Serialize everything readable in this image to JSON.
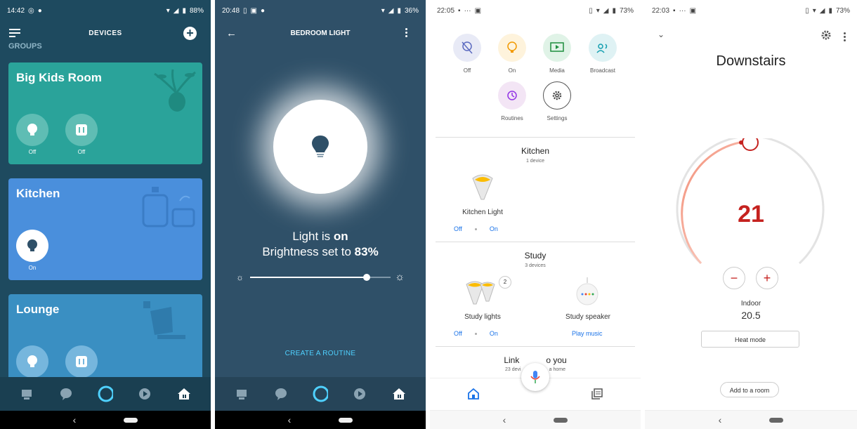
{
  "panel1": {
    "status": {
      "time": "14:42",
      "battery": "88%"
    },
    "title": "DEVICES",
    "groups_label": "GROUPS",
    "cards": [
      {
        "name": "Big Kids Room",
        "devices": [
          {
            "state": "Off"
          },
          {
            "state": "Off"
          }
        ]
      },
      {
        "name": "Kitchen",
        "devices": [
          {
            "state": "On"
          }
        ]
      },
      {
        "name": "Lounge"
      }
    ]
  },
  "panel2": {
    "status": {
      "time": "20:48",
      "battery": "36%"
    },
    "title": "BEDROOM LIGHT",
    "light_prefix": "Light is ",
    "light_state": "on",
    "brightness_prefix": "Brightness set to ",
    "brightness": "83%",
    "brightness_level": 0.83,
    "routine_link": "CREATE A ROUTINE"
  },
  "panel3": {
    "status": {
      "time": "22:05",
      "battery": "73%"
    },
    "actions": [
      "Off",
      "On",
      "Media",
      "Broadcast",
      "Routines",
      "Settings"
    ],
    "rooms": [
      {
        "name": "Kitchen",
        "count": "1 device",
        "devices": [
          {
            "name": "Kitchen Light",
            "off": "Off",
            "on": "On"
          }
        ]
      },
      {
        "name": "Study",
        "count": "3 devices",
        "devices": [
          {
            "name": "Study lights",
            "badge": "2",
            "off": "Off",
            "on": "On"
          },
          {
            "name": "Study speaker",
            "action": "Play music"
          }
        ]
      },
      {
        "name_left": "Link",
        "name_right": "o you",
        "count_left": "23 devi",
        "count_right": "a home"
      }
    ]
  },
  "panel4": {
    "status": {
      "time": "22:03",
      "battery": "73%"
    },
    "title": "Downstairs",
    "setpoint": "21",
    "indoor_label": "Indoor",
    "indoor_value": "20.5",
    "mode_button": "Heat mode",
    "room_button": "Add to a room",
    "minus": "−",
    "plus": "+"
  },
  "colors": {
    "alexa_bg": "#1e4a5f",
    "card_teal": "#2aa39a",
    "card_blue": "#4a8fdc",
    "card_lounge": "#3a8fc2",
    "accent_cyan": "#4fd1ff",
    "google_blue": "#1a73e8",
    "thermo_red": "#c5221f"
  }
}
